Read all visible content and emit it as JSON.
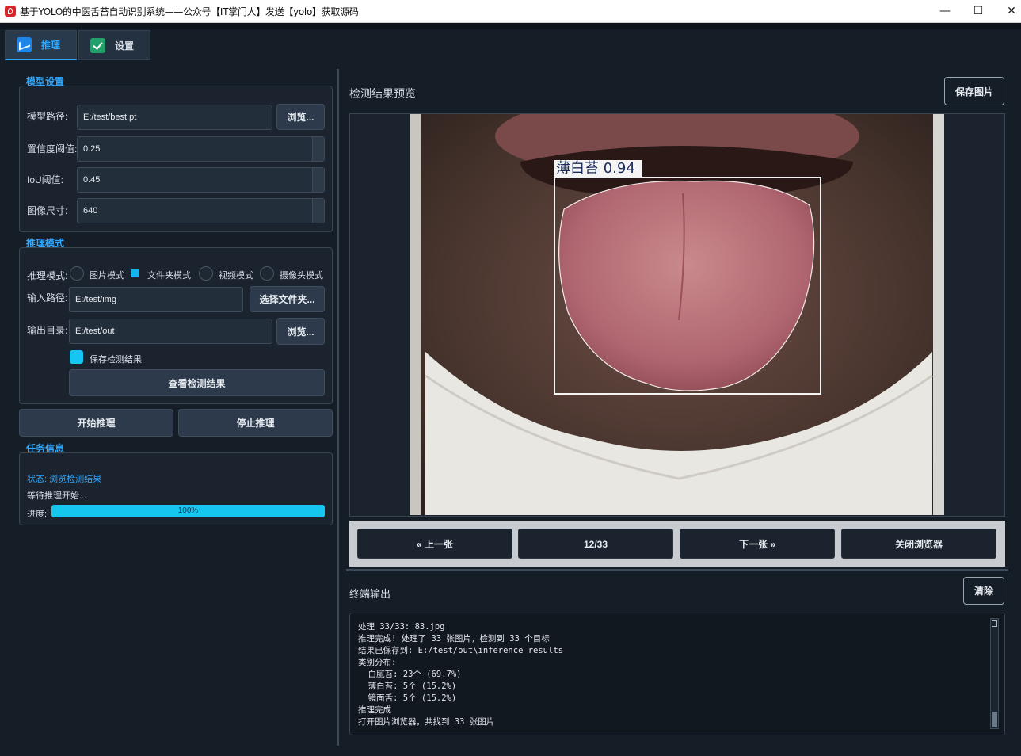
{
  "window": {
    "title": "基于YOLO的中医舌苔自动识别系统——公众号【IT掌门人】发送【yolo】获取源码",
    "minimize": "—",
    "maximize": "☐",
    "close": "✕"
  },
  "tabs": [
    {
      "label": "推理",
      "icon": "chart-icon"
    },
    {
      "label": "设置",
      "icon": "check-icon"
    }
  ],
  "model_settings": {
    "title": "模型设置",
    "model_path_label": "模型路径:",
    "model_path": "E:/test/best.pt",
    "browse": "浏览...",
    "conf_label": "置信度阈值:",
    "conf": "0.25",
    "iou_label": "IoU阈值:",
    "iou": "0.45",
    "imgsz_label": "图像尺寸:",
    "imgsz": "640"
  },
  "inference_mode": {
    "title": "推理模式",
    "mode_label": "推理模式:",
    "modes": [
      "图片模式",
      "文件夹模式",
      "视频模式",
      "摄像头模式"
    ],
    "selected_mode": "文件夹模式",
    "input_label": "输入路径:",
    "input_path": "E:/test/img",
    "choose_folder": "选择文件夹...",
    "output_label": "输出目录:",
    "output_path": "E:/test/out",
    "browse": "浏览...",
    "save_results": "保存检测结果",
    "save_checked": true,
    "view_results": "查看检测结果"
  },
  "actions": {
    "start": "开始推理",
    "stop": "停止推理"
  },
  "task_info": {
    "title": "任务信息",
    "status": "状态: 浏览检测结果",
    "message": "等待推理开始...",
    "progress_label": "进度:",
    "progress_text": "100%",
    "progress_value": 100
  },
  "preview": {
    "title": "检测结果预览",
    "save_image": "保存图片",
    "detection_label": "薄白苔 0.94",
    "prev": "« 上一张",
    "counter": "12/33",
    "next": "下一张 »",
    "close_browser": "关闭浏览器"
  },
  "terminal": {
    "title": "终端输出",
    "clear": "清除",
    "lines": [
      "处理 33/33: 83.jpg",
      "推理完成! 处理了 33 张图片，检测到 33 个目标",
      "结果已保存到: E:/test/out\\inference_results",
      "类别分布:",
      "  白腻苔: 23个 (69.7%)",
      "  薄白苔: 5个 (15.2%)",
      "  镜面舌: 5个 (15.2%)",
      "推理完成",
      "打开图片浏览器，共找到 33 张图片"
    ]
  },
  "colors": {
    "accent": "#2fa8ff",
    "progress": "#14c6f0",
    "background": "#151d27"
  }
}
